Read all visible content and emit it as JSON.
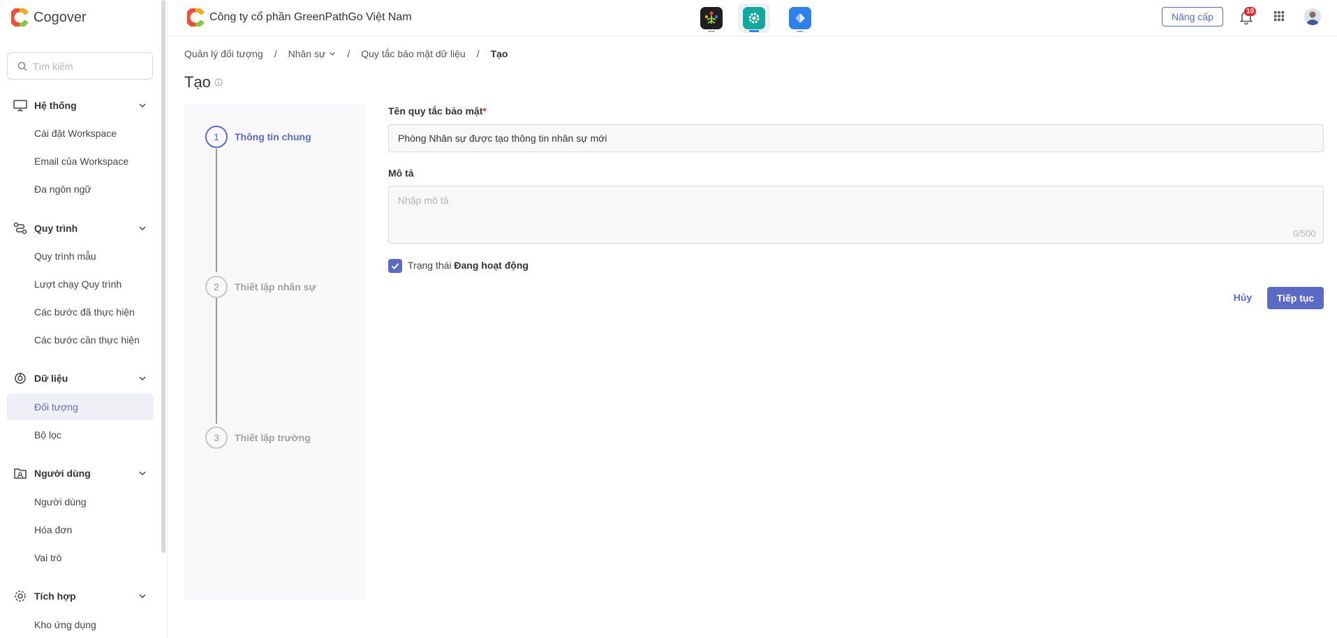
{
  "app": {
    "name": "Cogover"
  },
  "search": {
    "placeholder": "Tìm kiếm"
  },
  "sidebar": {
    "groups": [
      {
        "label": "Hệ thống",
        "icon": "monitor-icon",
        "items": [
          "Cài đặt Workspace",
          "Email của Workspace",
          "Đa ngôn ngữ"
        ]
      },
      {
        "label": "Quy trình",
        "icon": "workflow-icon",
        "items": [
          "Quy trình mẫu",
          "Lượt chạy Quy trình",
          "Các bước đã thực hiện",
          "Các bước cần thực hiện"
        ]
      },
      {
        "label": "Dữ liệu",
        "icon": "data-icon",
        "items": [
          "Đối tượng",
          "Bộ lọc"
        ]
      },
      {
        "label": "Người dùng",
        "icon": "user-folder-icon",
        "items": [
          "Người dùng",
          "Hóa đơn",
          "Vai trò"
        ]
      },
      {
        "label": "Tích hợp",
        "icon": "integration-icon",
        "items": [
          "Kho ứng dụng"
        ]
      }
    ],
    "active_item": "Đối tượng"
  },
  "header": {
    "company": "Công ty cổ phần GreenPathGo Việt Nam",
    "apps": [
      {
        "icon": "people-tree-app-icon",
        "color": "#1f1f1f"
      },
      {
        "icon": "settings-app-icon",
        "color": "#13a89e",
        "selected": true
      },
      {
        "icon": "diamond-app-icon",
        "color": "#2f80ed"
      }
    ],
    "upgrade_label": "Nâng cấp",
    "notification_count": "10"
  },
  "breadcrumb": [
    "Quản lý đối tượng",
    "Nhân sự",
    "Quy tắc bảo mật dữ liệu",
    "Tạo"
  ],
  "page": {
    "title": "Tạo"
  },
  "steps": [
    {
      "number": "1",
      "label": "Thông tin chung",
      "active": true
    },
    {
      "number": "2",
      "label": "Thiết lập nhân sự",
      "active": false
    },
    {
      "number": "3",
      "label": "Thiết lập trường",
      "active": false
    }
  ],
  "form": {
    "name_label": "Tên quy tắc bảo mật",
    "required_mark": "*",
    "name_value": "Phòng Nhân sự được tạo thông tin nhân sự mới",
    "desc_label": "Mô tả",
    "desc_placeholder": "Nhập mô tả",
    "desc_counter": "0/500",
    "status_prefix": "Trạng thái",
    "status_value": "Đang hoạt động",
    "status_checked": true,
    "cancel_label": "Hủy",
    "next_label": "Tiếp tục"
  },
  "colors": {
    "accent": "#5b6ac4",
    "danger": "#e0262b"
  }
}
